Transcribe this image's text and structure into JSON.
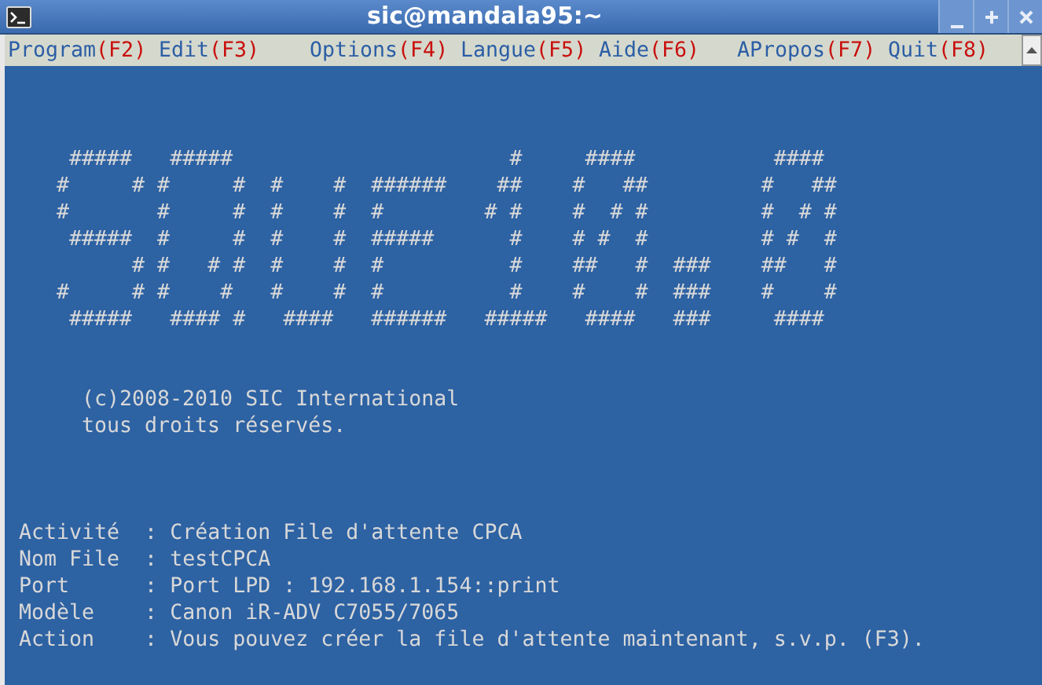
{
  "window": {
    "title": "sic@mandala95:~"
  },
  "menu": [
    {
      "label": "Program",
      "key": "(F2)"
    },
    {
      "label": "Edit",
      "key": "(F3)"
    },
    {
      "label": "Options",
      "key": "(F4)"
    },
    {
      "label": "Langue",
      "key": "(F5)"
    },
    {
      "label": "Aide",
      "key": "(F6)"
    },
    {
      "label": "APropos",
      "key": "(F7)"
    },
    {
      "label": "Quit",
      "key": "(F8)"
    }
  ],
  "ascii_art": [
    "    #####   #####                      #     ####           ####",
    "   #     # #     #  #    #  ######    ##    #   ##         #   ##",
    "   #       #     #  #    #  #        # #    #  # #         #  # #",
    "    #####  #     #  #    #  #####      #    # #  #         # #  #",
    "         # #   # #  #    #  #          #    ##   #  ###    ##   #",
    "   #     # #    #   #    #  #          #    #    #  ###    #    #",
    "    #####   #### #   ####   ######   #####   ####   ###     ####"
  ],
  "copyright": [
    "(c)2008-2010 SIC International",
    "tous droits réservés."
  ],
  "info": [
    "Activité  : Création File d'attente CPCA",
    "Nom File  : testCPCA",
    "Port      : Port LPD : 192.168.1.154::print",
    "Modèle    : Canon iR-ADV C7055/7065",
    "Action    : Vous pouvez créer la file d'attente maintenant, s.v.p. (F3)."
  ]
}
